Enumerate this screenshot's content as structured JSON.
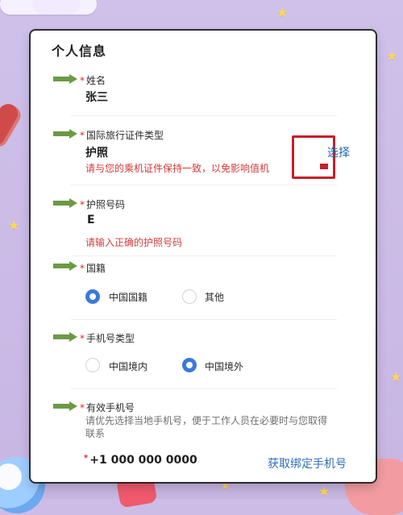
{
  "page": {
    "title": "个人信息"
  },
  "fields": {
    "name": {
      "label": "姓名",
      "value": "张三"
    },
    "document_type": {
      "label": "国际旅行证件类型",
      "value": "护照",
      "select_label": "选择",
      "hint": "请与您的乘机证件保持一致，以免影响值机"
    },
    "passport_number": {
      "label": "护照号码",
      "value": "E",
      "hint": "请输入正确的护照号码"
    },
    "nationality": {
      "label": "国籍",
      "options": [
        "中国国籍",
        "其他"
      ],
      "selected": "中国国籍"
    },
    "phone_type": {
      "label": "手机号类型",
      "options": [
        "中国境内",
        "中国境外"
      ],
      "selected": "中国境外"
    },
    "valid_phone": {
      "label": "有效手机号",
      "desc_line1": "请优先选择当地手机号，便于工作人员在必要时与您取得",
      "desc_line2": "联系",
      "value": "+1 000 000 0000",
      "bind_label": "获取绑定手机号"
    }
  },
  "colors": {
    "required": "#d42a2a",
    "hint_red": "#d43a3a",
    "link_blue": "#2f6fb4",
    "radio_blue": "#3b79da",
    "arrow_green": "#6b9a43",
    "highlight_red": "#c71f2b"
  }
}
